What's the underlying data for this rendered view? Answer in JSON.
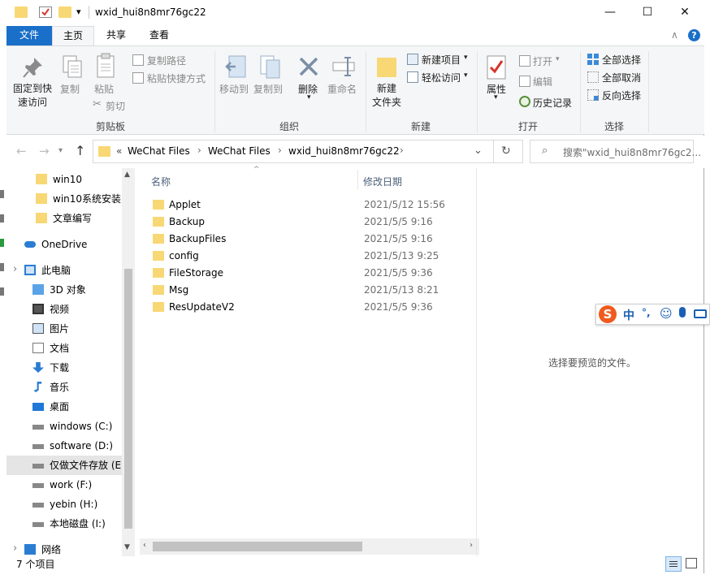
{
  "titlebar": {
    "title": "wxid_hui8n8mr76gc22",
    "qat_dropdown": "▾",
    "minimize": "—",
    "maximize": "☐",
    "close": "✕"
  },
  "tabs": {
    "file": "文件",
    "home": "主页",
    "share": "共享",
    "view": "查看",
    "collapse_icon": "∧",
    "help_icon": "?"
  },
  "ribbon": {
    "clipboard": {
      "pin": "固定到快速访问",
      "pin_line1": "固定到快",
      "pin_line2": "速访问",
      "copy": "复制",
      "paste": "粘贴",
      "copy_path": "复制路径",
      "paste_shortcut": "粘贴快捷方式",
      "cut": "剪切",
      "group": "剪贴板"
    },
    "organize": {
      "move_to": "移动到",
      "copy_to": "复制到",
      "delete": "删除",
      "rename": "重命名",
      "group": "组织"
    },
    "new": {
      "new_folder_line1": "新建",
      "new_folder_line2": "文件夹",
      "new_item": "新建项目",
      "easy_access": "轻松访问",
      "group": "新建"
    },
    "open": {
      "properties": "属性",
      "open": "打开",
      "edit": "编辑",
      "history": "历史记录",
      "group": "打开"
    },
    "select": {
      "select_all": "全部选择",
      "select_none": "全部取消",
      "invert": "反向选择",
      "group": "选择"
    }
  },
  "address": {
    "overflow": "«",
    "crumbs": [
      "WeChat Files",
      "WeChat Files",
      "wxid_hui8n8mr76gc22"
    ],
    "search_placeholder": "搜索\"wxid_hui8n8mr76gc2..."
  },
  "nav": [
    {
      "label": "win10",
      "icon": "folder-icon"
    },
    {
      "label": "win10系统安装",
      "icon": "folder-icon"
    },
    {
      "label": "文章编写",
      "icon": "folder-icon"
    },
    {
      "label": "OneDrive",
      "icon": "cloud-icon"
    },
    {
      "label": "此电脑",
      "icon": "computer-icon"
    },
    {
      "label": "3D 对象",
      "icon": "cube-icon"
    },
    {
      "label": "视频",
      "icon": "video-icon"
    },
    {
      "label": "图片",
      "icon": "picture-icon"
    },
    {
      "label": "文档",
      "icon": "document-icon"
    },
    {
      "label": "下载",
      "icon": "download-icon"
    },
    {
      "label": "音乐",
      "icon": "music-icon"
    },
    {
      "label": "桌面",
      "icon": "desktop-icon"
    },
    {
      "label": "windows (C:)",
      "icon": "drive-icon"
    },
    {
      "label": "software (D:)",
      "icon": "drive-icon"
    },
    {
      "label": "仅做文件存放 (E",
      "icon": "drive-icon"
    },
    {
      "label": "work (F:)",
      "icon": "drive-icon"
    },
    {
      "label": "yebin (H:)",
      "icon": "drive-icon"
    },
    {
      "label": "本地磁盘 (I:)",
      "icon": "drive-icon"
    },
    {
      "label": "网络",
      "icon": "network-icon"
    }
  ],
  "list": {
    "col_name": "名称",
    "col_date": "修改日期",
    "rows": [
      {
        "name": "Applet",
        "date": "2021/5/12 15:56"
      },
      {
        "name": "Backup",
        "date": "2021/5/5 9:16"
      },
      {
        "name": "BackupFiles",
        "date": "2021/5/5 9:16"
      },
      {
        "name": "config",
        "date": "2021/5/13 9:25"
      },
      {
        "name": "FileStorage",
        "date": "2021/5/5 9:36"
      },
      {
        "name": "Msg",
        "date": "2021/5/13 8:21"
      },
      {
        "name": "ResUpdateV2",
        "date": "2021/5/5 9:36"
      }
    ]
  },
  "preview": {
    "text": "选择要预览的文件。"
  },
  "status": {
    "count": "7 个项目"
  },
  "ime": {
    "mode": "中",
    "punct": "°,"
  },
  "colors": {
    "accent": "#1a6fc9",
    "folder": "#f8d775",
    "selection": "#e5e5e5"
  }
}
